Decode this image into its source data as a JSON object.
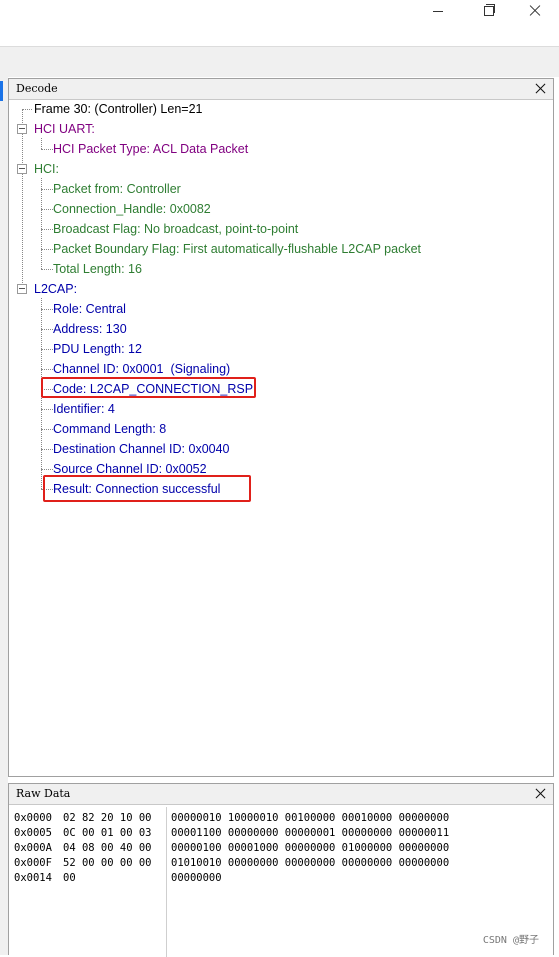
{
  "decode_panel": {
    "title": "Decode",
    "nodes": [
      {
        "text": "Frame 30: (Controller) Len=21",
        "color": "#000000"
      },
      {
        "text": "HCI UART:",
        "color": "#800080"
      },
      {
        "text": "HCI Packet Type: ACL Data Packet",
        "color": "#800080"
      },
      {
        "text": "HCI:",
        "color": "#2e7d32"
      },
      {
        "text": "Packet from: Controller",
        "color": "#2e7d32"
      },
      {
        "text": "Connection_Handle: 0x0082",
        "color": "#2e7d32"
      },
      {
        "text": "Broadcast Flag: No broadcast, point-to-point",
        "color": "#2e7d32"
      },
      {
        "text": "Packet Boundary Flag: First automatically-flushable L2CAP packet",
        "color": "#2e7d32"
      },
      {
        "text": "Total Length: 16",
        "color": "#2e7d32"
      },
      {
        "text": "L2CAP:",
        "color": "#0000aa"
      },
      {
        "text": "Role: Central",
        "color": "#0000aa"
      },
      {
        "text": "Address: 130",
        "color": "#0000aa"
      },
      {
        "text": "PDU Length: 12",
        "color": "#0000aa"
      },
      {
        "text": "Channel ID: 0x0001  (Signaling)",
        "color": "#0000aa"
      },
      {
        "text": "Code: L2CAP_CONNECTION_RSP",
        "color": "#0000aa"
      },
      {
        "text": "Identifier: 4",
        "color": "#0000aa"
      },
      {
        "text": "Command Length: 8",
        "color": "#0000aa"
      },
      {
        "text": "Destination Channel ID: 0x0040",
        "color": "#0000aa"
      },
      {
        "text": "Source Channel ID: 0x0052",
        "color": "#0000aa"
      },
      {
        "text": "Result: Connection successful",
        "color": "#0000aa"
      }
    ]
  },
  "raw_panel": {
    "title": "Raw Data",
    "rows": [
      {
        "offset": "0x0000",
        "hex": "02 82 20 10 00",
        "bin": "00000010 10000010 00100000 00010000 00000000"
      },
      {
        "offset": "0x0005",
        "hex": "0C 00 01 00 03",
        "bin": "00001100 00000000 00000001 00000000 00000011"
      },
      {
        "offset": "0x000A",
        "hex": "04 08 00 40 00",
        "bin": "00000100 00001000 00000000 01000000 00000000"
      },
      {
        "offset": "0x000F",
        "hex": "52 00 00 00 00",
        "bin": "01010010 00000000 00000000 00000000 00000000"
      },
      {
        "offset": "0x0014",
        "hex": "00",
        "bin": "00000000"
      }
    ]
  },
  "watermark": "CSDN @野子",
  "colors": {
    "highlight_box": "#e0201a",
    "toolbar_bg": "#f0f0f0"
  }
}
